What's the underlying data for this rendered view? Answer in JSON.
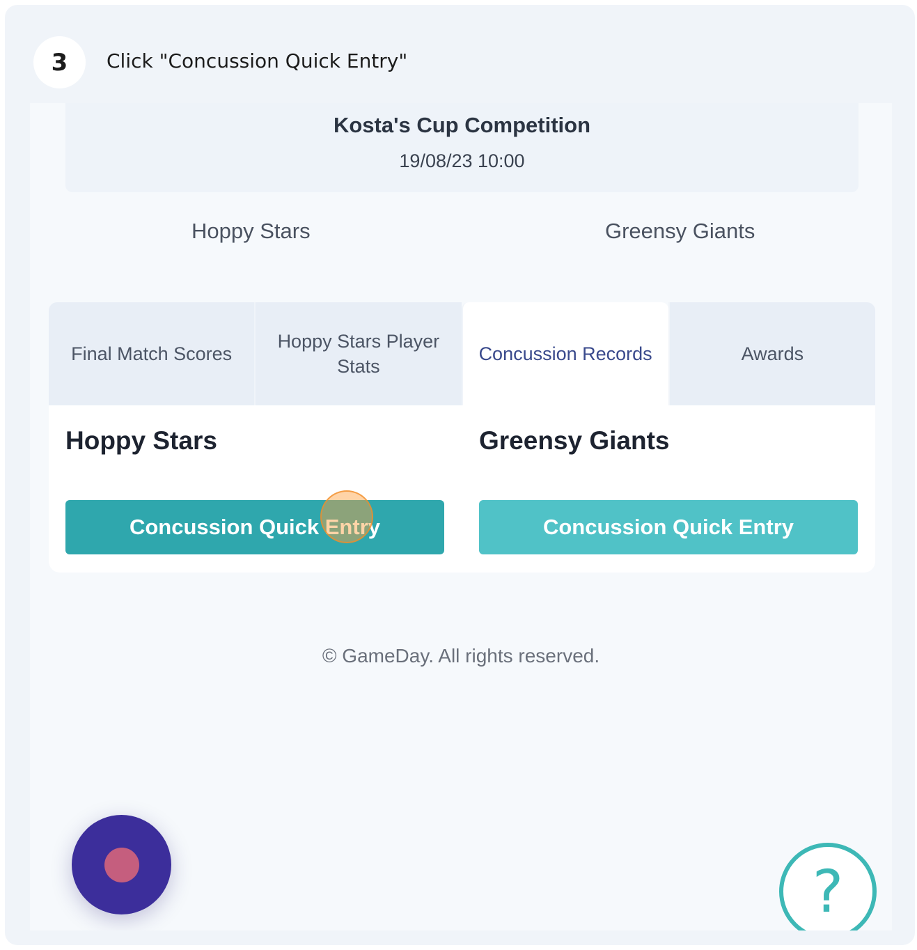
{
  "step": {
    "number": "3",
    "instruction": "Click \"Concussion Quick Entry\""
  },
  "match": {
    "competition": "Kosta's Cup Competition",
    "datetime": "19/08/23 10:00",
    "home_team": "Hoppy Stars",
    "away_team": "Greensy Giants"
  },
  "tabs": [
    {
      "label": "Final Match Scores",
      "active": false
    },
    {
      "label": "Hoppy Stars Player Stats",
      "active": false
    },
    {
      "label": "Concussion Records",
      "active": true
    },
    {
      "label": "Awards",
      "active": false
    }
  ],
  "panel": {
    "left_team": "Hoppy Stars",
    "right_team": "Greensy Giants",
    "left_button": "Concussion Quick Entry",
    "right_button": "Concussion Quick Entry"
  },
  "footer": {
    "copyright": "© GameDay. All rights reserved."
  },
  "widgets": {
    "record_icon": "record-icon",
    "help_icon": "help-icon",
    "help_glyph": "?"
  },
  "colors": {
    "accent_teal": "#2fa7ad",
    "accent_teal_light": "#50c2c7",
    "active_tab_text": "#3a4a8c",
    "record_fab": "#3c2e9b",
    "click_marker": "#f08c28"
  }
}
